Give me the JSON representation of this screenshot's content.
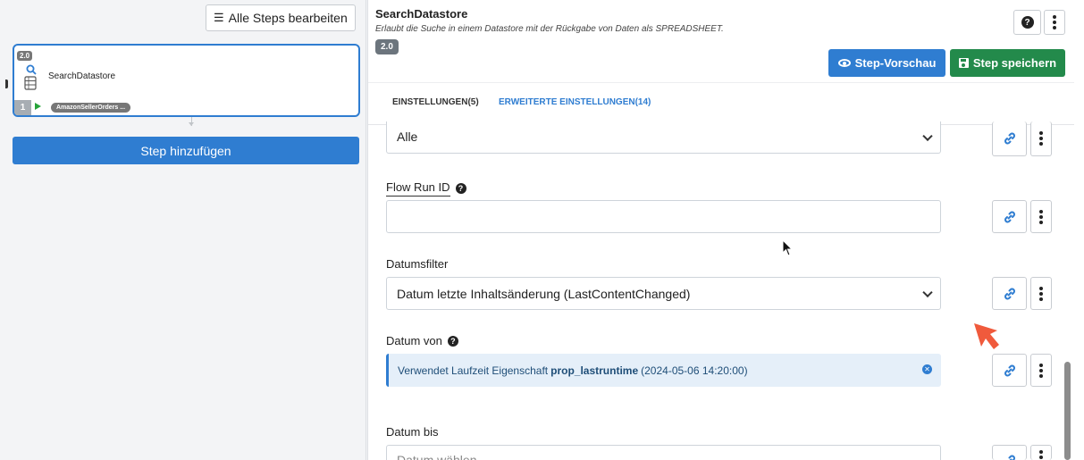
{
  "left_panel": {
    "edit_all_label": "Alle Steps bearbeiten",
    "step": {
      "version": "2.0",
      "name": "SearchDatastore",
      "number": "1",
      "source": "AmazonSellerOrders ..."
    },
    "add_step_label": "Step hinzufügen"
  },
  "header": {
    "title": "SearchDatastore",
    "subtitle": "Erlaubt die Suche in einem Datastore mit der Rückgabe von Daten als SPREADSHEET.",
    "version": "2.0",
    "help_glyph": "?",
    "preview_label": "Step-Vorschau",
    "save_label": "Step speichern"
  },
  "tabs": [
    {
      "label": "EINSTELLUNGEN(5)"
    },
    {
      "label": "ERWEITERTE EINSTELLUNGEN(14)"
    }
  ],
  "fields": {
    "top_select_value": "Alle",
    "flow_run_id": {
      "label": "Flow Run ID",
      "value": ""
    },
    "datumsfilter": {
      "label": "Datumsfilter",
      "value": "Datum letzte Inhaltsänderung (LastContentChanged)"
    },
    "datum_von": {
      "label": "Datum von",
      "info_prefix": "Verwendet Laufzeit Eigenschaft",
      "info_property": "prop_lastruntime",
      "info_value": "(2024-05-06 14:20:00)"
    },
    "datum_bis": {
      "label": "Datum bis",
      "placeholder": "Datum wählen"
    }
  },
  "icons": {
    "list": "list-icon",
    "search": "search-icon",
    "database": "database-icon",
    "play": "play-icon",
    "help": "help-icon",
    "more": "more-vertical-icon",
    "eye": "eye-icon",
    "save": "floppy-disk-icon",
    "link": "link-icon",
    "clear": "clear-circle-icon",
    "chevron": "chevron-down-icon"
  },
  "colors": {
    "primary": "#2f7dd1",
    "success": "#238a4b",
    "badge": "#6c757d",
    "info_bg": "#e5eff9"
  }
}
